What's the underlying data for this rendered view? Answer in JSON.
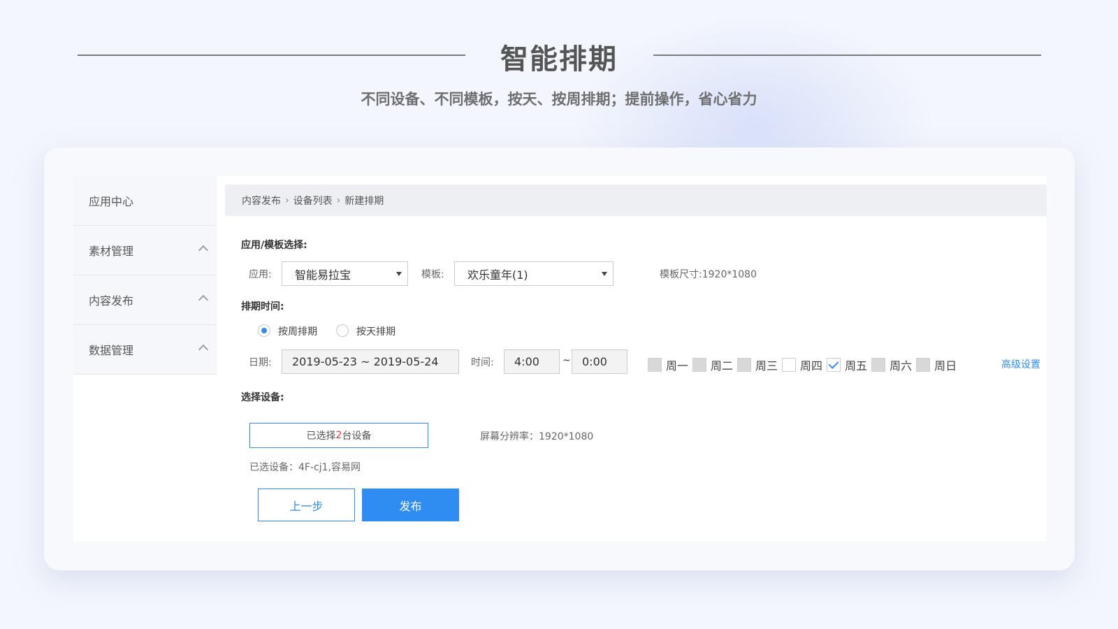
{
  "hero": {
    "title": "智能排期",
    "subtitle": "不同设备、不同模板，按天、按周排期；提前操作，省心省力"
  },
  "sidebar": {
    "items": [
      {
        "label": "应用中心",
        "has_chevron": false
      },
      {
        "label": "素材管理",
        "has_chevron": true
      },
      {
        "label": "内容发布",
        "has_chevron": true
      },
      {
        "label": "数据管理",
        "has_chevron": true
      }
    ]
  },
  "breadcrumb": {
    "items": [
      "内容发布",
      "设备列表",
      "新建排期"
    ],
    "separator": "›"
  },
  "form": {
    "app_template_label": "应用/模板选择:",
    "app_label": "应用:",
    "app_value": "智能易拉宝",
    "template_label": "模板:",
    "template_value": "欢乐童年(1)",
    "template_size": "模板尺寸:1920*1080",
    "schedule_label": "排期时间:",
    "radio_week": "按周排期",
    "radio_day": "按天排期",
    "date_label": "日期:",
    "date_value": "2019-05-23 ~ 2019-05-24",
    "time_label": "时间:",
    "time_start": "4:00",
    "time_sep": "~",
    "time_end": "0:00",
    "weekdays": [
      {
        "label": "周一",
        "state": "disabled"
      },
      {
        "label": "周二",
        "state": "disabled"
      },
      {
        "label": "周三",
        "state": "disabled"
      },
      {
        "label": "周四",
        "state": "unchecked"
      },
      {
        "label": "周五",
        "state": "checked"
      },
      {
        "label": "周六",
        "state": "disabled"
      },
      {
        "label": "周日",
        "state": "disabled"
      }
    ],
    "advanced": "高级设置",
    "device_label": "选择设备:",
    "device_btn_prefix": "已选择",
    "device_btn_count": "2",
    "device_btn_suffix": "台设备",
    "resolution": "屏幕分辨率：1920*1080",
    "selected_devices": "已选设备：4F-cj1,容易网"
  },
  "actions": {
    "prev": "上一步",
    "publish": "发布"
  },
  "colors": {
    "accent": "#2f8cf0",
    "highlight": "#e33333"
  }
}
